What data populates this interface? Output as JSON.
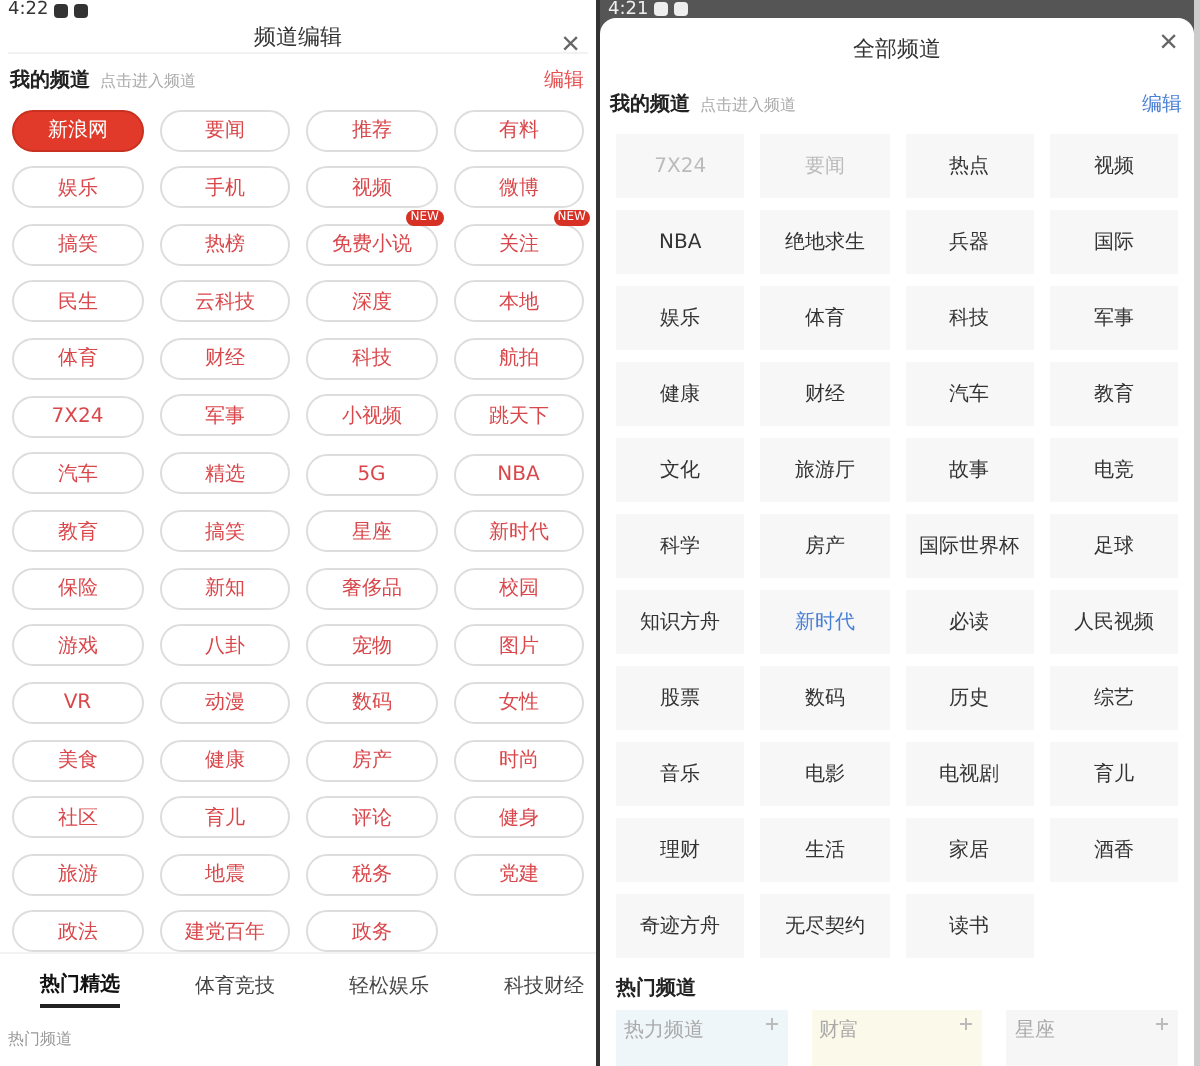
{
  "left": {
    "status_bar": {
      "time": "4:22"
    },
    "title": "频道编辑",
    "close": "×",
    "section": {
      "title": "我的频道",
      "hint": "点击进入频道",
      "action": "编辑"
    },
    "channels": [
      {
        "label": "新浪网",
        "selected": true
      },
      {
        "label": "要闻",
        "selected": false
      },
      {
        "label": "推荐",
        "selected": false
      },
      {
        "label": "有料",
        "selected": false
      },
      {
        "label": "娱乐",
        "selected": false
      },
      {
        "label": "手机",
        "selected": false
      },
      {
        "label": "视频",
        "selected": false
      },
      {
        "label": "微博",
        "selected": false
      },
      {
        "label": "搞笑",
        "selected": false
      },
      {
        "label": "热榜",
        "selected": false
      },
      {
        "label": "免费小说",
        "selected": false,
        "badge": "NEW"
      },
      {
        "label": "关注",
        "selected": false,
        "badge": "NEW"
      },
      {
        "label": "民生",
        "selected": false
      },
      {
        "label": "云科技",
        "selected": false
      },
      {
        "label": "深度",
        "selected": false
      },
      {
        "label": "本地",
        "selected": false
      },
      {
        "label": "体育",
        "selected": false
      },
      {
        "label": "财经",
        "selected": false
      },
      {
        "label": "科技",
        "selected": false
      },
      {
        "label": "航拍",
        "selected": false
      },
      {
        "label": "7X24",
        "selected": false
      },
      {
        "label": "军事",
        "selected": false
      },
      {
        "label": "小视频",
        "selected": false
      },
      {
        "label": "跳天下",
        "selected": false
      },
      {
        "label": "汽车",
        "selected": false
      },
      {
        "label": "精选",
        "selected": false
      },
      {
        "label": "5G",
        "selected": false
      },
      {
        "label": "NBA",
        "selected": false
      },
      {
        "label": "教育",
        "selected": false
      },
      {
        "label": "搞笑",
        "selected": false
      },
      {
        "label": "星座",
        "selected": false
      },
      {
        "label": "新时代",
        "selected": false
      },
      {
        "label": "保险",
        "selected": false
      },
      {
        "label": "新知",
        "selected": false
      },
      {
        "label": "奢侈品",
        "selected": false
      },
      {
        "label": "校园",
        "selected": false
      },
      {
        "label": "游戏",
        "selected": false
      },
      {
        "label": "八卦",
        "selected": false
      },
      {
        "label": "宠物",
        "selected": false
      },
      {
        "label": "图片",
        "selected": false
      },
      {
        "label": "VR",
        "selected": false
      },
      {
        "label": "动漫",
        "selected": false
      },
      {
        "label": "数码",
        "selected": false
      },
      {
        "label": "女性",
        "selected": false
      },
      {
        "label": "美食",
        "selected": false
      },
      {
        "label": "健康",
        "selected": false
      },
      {
        "label": "房产",
        "selected": false
      },
      {
        "label": "时尚",
        "selected": false
      },
      {
        "label": "社区",
        "selected": false
      },
      {
        "label": "育儿",
        "selected": false
      },
      {
        "label": "评论",
        "selected": false
      },
      {
        "label": "健身",
        "selected": false
      },
      {
        "label": "旅游",
        "selected": false
      },
      {
        "label": "地震",
        "selected": false
      },
      {
        "label": "税务",
        "selected": false
      },
      {
        "label": "党建",
        "selected": false
      },
      {
        "label": "政法",
        "selected": false
      },
      {
        "label": "建党百年",
        "selected": false
      },
      {
        "label": "政务",
        "selected": false
      }
    ],
    "tabs": [
      {
        "label": "热门精选",
        "selected": true
      },
      {
        "label": "体育竞技",
        "selected": false
      },
      {
        "label": "轻松娱乐",
        "selected": false
      },
      {
        "label": "科技财经",
        "selected": false
      }
    ],
    "footer_label": "热门频道"
  },
  "right": {
    "status_bar": {
      "time": "4:21"
    },
    "title": "全部频道",
    "close": "×",
    "section": {
      "title": "我的频道",
      "hint": "点击进入频道",
      "action": "编辑"
    },
    "channels": [
      {
        "label": "7X24",
        "disabled": true,
        "highlighted": false
      },
      {
        "label": "要闻",
        "disabled": true,
        "highlighted": false
      },
      {
        "label": "热点",
        "disabled": false,
        "highlighted": false
      },
      {
        "label": "视频",
        "disabled": false,
        "highlighted": false
      },
      {
        "label": "NBA",
        "disabled": false,
        "highlighted": false
      },
      {
        "label": "绝地求生",
        "disabled": false,
        "highlighted": false
      },
      {
        "label": "兵器",
        "disabled": false,
        "highlighted": false
      },
      {
        "label": "国际",
        "disabled": false,
        "highlighted": false
      },
      {
        "label": "娱乐",
        "disabled": false,
        "highlighted": false
      },
      {
        "label": "体育",
        "disabled": false,
        "highlighted": false
      },
      {
        "label": "科技",
        "disabled": false,
        "highlighted": false
      },
      {
        "label": "军事",
        "disabled": false,
        "highlighted": false
      },
      {
        "label": "健康",
        "disabled": false,
        "highlighted": false
      },
      {
        "label": "财经",
        "disabled": false,
        "highlighted": false
      },
      {
        "label": "汽车",
        "disabled": false,
        "highlighted": false
      },
      {
        "label": "教育",
        "disabled": false,
        "highlighted": false
      },
      {
        "label": "文化",
        "disabled": false,
        "highlighted": false
      },
      {
        "label": "旅游厅",
        "disabled": false,
        "highlighted": false
      },
      {
        "label": "故事",
        "disabled": false,
        "highlighted": false
      },
      {
        "label": "电竞",
        "disabled": false,
        "highlighted": false
      },
      {
        "label": "科学",
        "disabled": false,
        "highlighted": false
      },
      {
        "label": "房产",
        "disabled": false,
        "highlighted": false
      },
      {
        "label": "国际世界杯",
        "disabled": false,
        "highlighted": false
      },
      {
        "label": "足球",
        "disabled": false,
        "highlighted": false
      },
      {
        "label": "知识方舟",
        "disabled": false,
        "highlighted": false
      },
      {
        "label": "新时代",
        "disabled": false,
        "highlighted": true
      },
      {
        "label": "必读",
        "disabled": false,
        "highlighted": false
      },
      {
        "label": "人民视频",
        "disabled": false,
        "highlighted": false
      },
      {
        "label": "股票",
        "disabled": false,
        "highlighted": false
      },
      {
        "label": "数码",
        "disabled": false,
        "highlighted": false
      },
      {
        "label": "历史",
        "disabled": false,
        "highlighted": false
      },
      {
        "label": "综艺",
        "disabled": false,
        "highlighted": false
      },
      {
        "label": "音乐",
        "disabled": false,
        "highlighted": false
      },
      {
        "label": "电影",
        "disabled": false,
        "highlighted": false
      },
      {
        "label": "电视剧",
        "disabled": false,
        "highlighted": false
      },
      {
        "label": "育儿",
        "disabled": false,
        "highlighted": false
      },
      {
        "label": "理财",
        "disabled": false,
        "highlighted": false
      },
      {
        "label": "生活",
        "disabled": false,
        "highlighted": false
      },
      {
        "label": "家居",
        "disabled": false,
        "highlighted": false
      },
      {
        "label": "酒香",
        "disabled": false,
        "highlighted": false
      },
      {
        "label": "奇迹方舟",
        "disabled": false,
        "highlighted": false
      },
      {
        "label": "无尽契约",
        "disabled": false,
        "highlighted": false
      },
      {
        "label": "读书",
        "disabled": false,
        "highlighted": false
      }
    ],
    "hot_title": "热门频道",
    "hot_cards": [
      {
        "title": "热力频道",
        "color": "#eef6fa"
      },
      {
        "title": "财富",
        "color": "#fbf9ea"
      },
      {
        "title": "星座",
        "color": "#f6f6f6"
      }
    ]
  }
}
